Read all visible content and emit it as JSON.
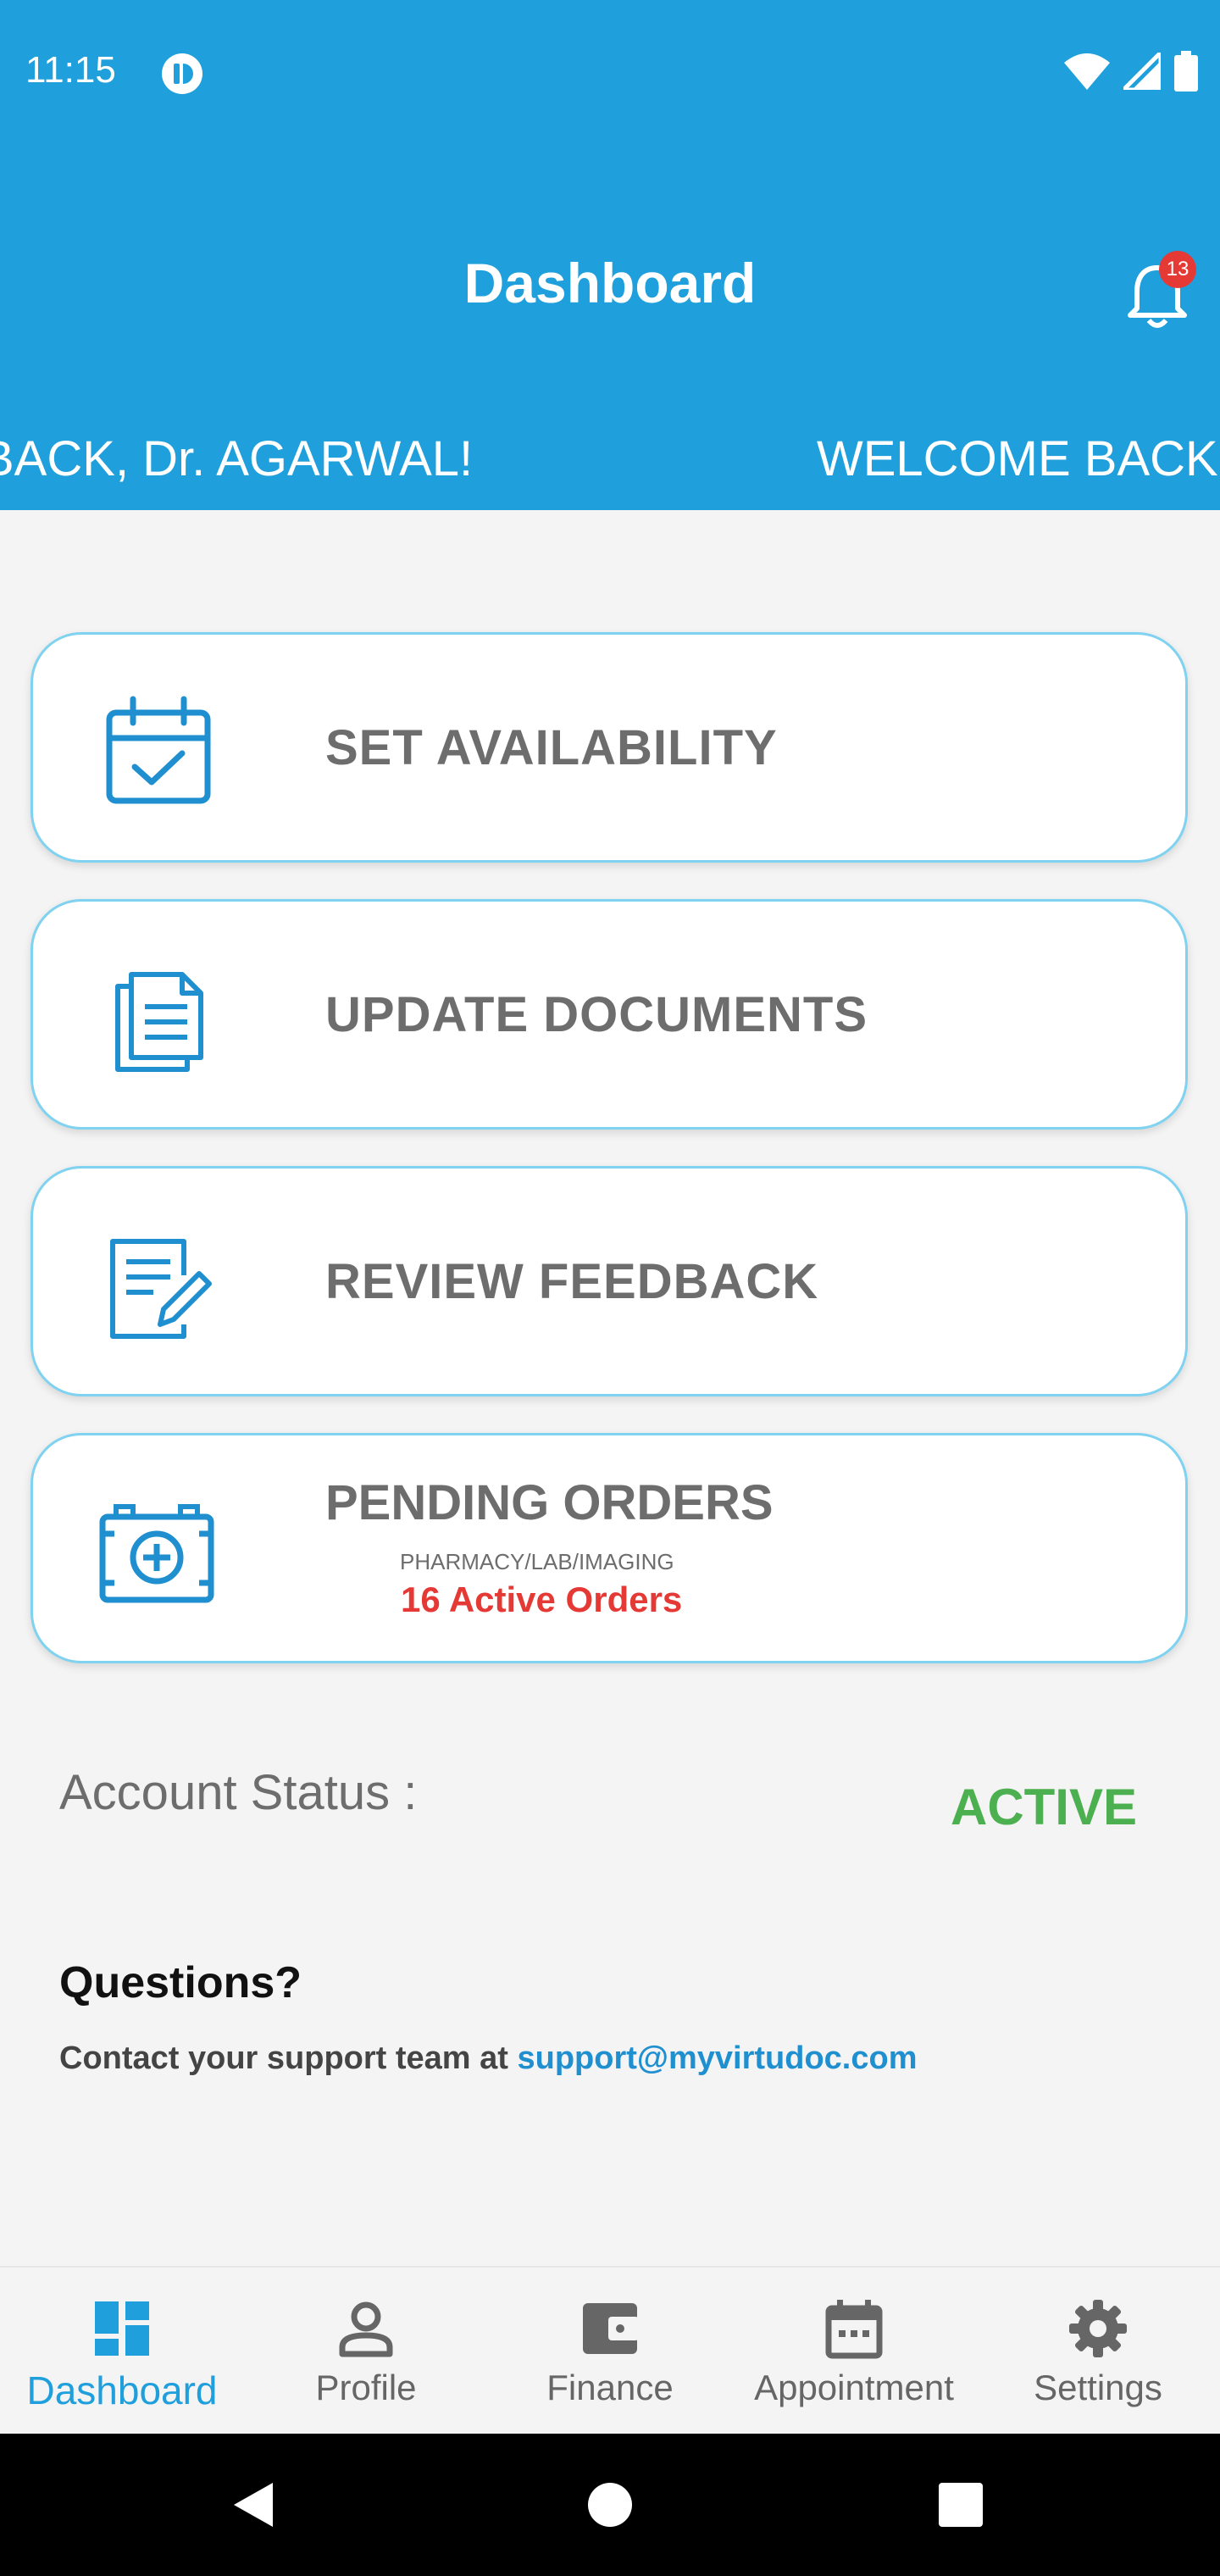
{
  "status_bar": {
    "time": "11:15"
  },
  "header": {
    "title": "Dashboard",
    "notification_count": "13",
    "marquee_left": "BACK,  Dr. AGARWAL!",
    "marquee_right": "WELCOME BACK"
  },
  "cards": [
    {
      "label": "SET AVAILABILITY",
      "icon": "calendar-check-icon"
    },
    {
      "label": "UPDATE DOCUMENTS",
      "icon": "documents-icon"
    },
    {
      "label": "REVIEW FEEDBACK",
      "icon": "edit-document-icon"
    },
    {
      "label": "PENDING ORDERS",
      "icon": "medical-kit-icon",
      "sub": "PHARMACY/LAB/IMAGING",
      "count": "16 Active Orders"
    }
  ],
  "account": {
    "label": "Account Status :",
    "value": "ACTIVE"
  },
  "support": {
    "heading": "Questions?",
    "text": "Contact your support team at ",
    "email": "support@myvirtudoc.com"
  },
  "bottom_nav": [
    {
      "label": "Dashboard",
      "icon": "dashboard-icon",
      "active": true
    },
    {
      "label": "Profile",
      "icon": "person-icon"
    },
    {
      "label": "Finance",
      "icon": "wallet-icon"
    },
    {
      "label": "Appointment",
      "icon": "calendar-icon"
    },
    {
      "label": "Settings",
      "icon": "gear-icon"
    }
  ],
  "colors": {
    "primary": "#1f9fdb",
    "active_green": "#4caf50",
    "alert_red": "#e53935"
  }
}
